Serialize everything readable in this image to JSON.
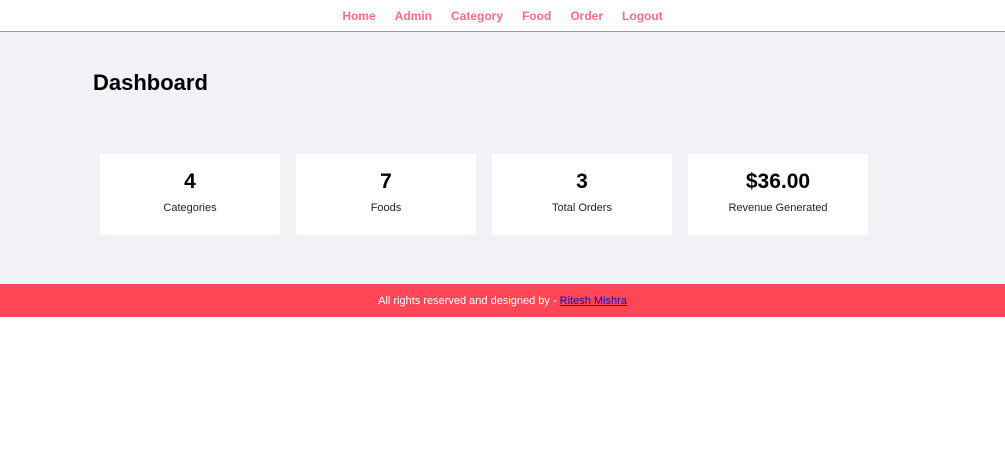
{
  "nav": {
    "items": [
      {
        "label": "Home"
      },
      {
        "label": "Admin"
      },
      {
        "label": "Category"
      },
      {
        "label": "Food"
      },
      {
        "label": "Order"
      },
      {
        "label": "Logout"
      }
    ]
  },
  "main": {
    "title": "Dashboard",
    "cards": [
      {
        "value": "4",
        "label": "Categories"
      },
      {
        "value": "7",
        "label": "Foods"
      },
      {
        "value": "3",
        "label": "Total Orders"
      },
      {
        "value": "$36.00",
        "label": "Revenue Generated"
      }
    ]
  },
  "footer": {
    "text": "All rights reserved and designed by -",
    "link_label": "Ritesh Mishra"
  },
  "colors": {
    "nav_link": "#ff6b81",
    "main_bg": "#f1f2f6",
    "footer_bg": "#ff4757"
  }
}
